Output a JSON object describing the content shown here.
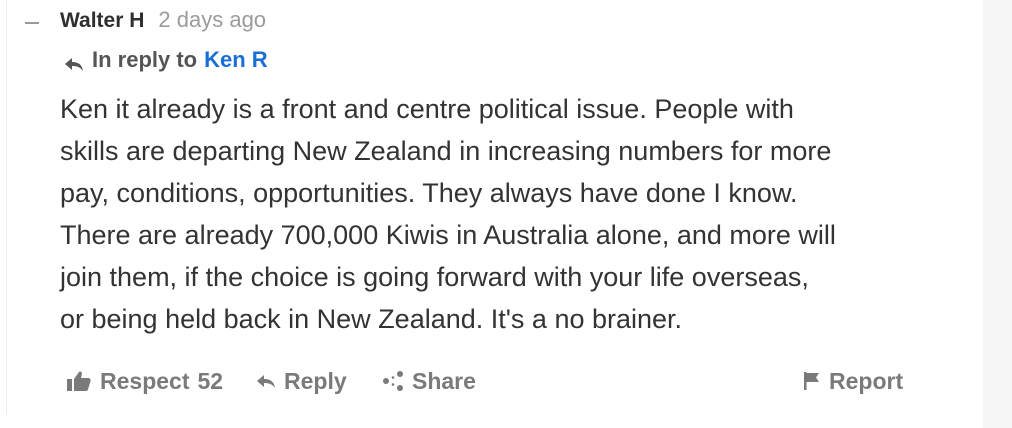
{
  "comment": {
    "author": "Walter H",
    "timestamp": "2 days ago",
    "reply_prefix": "In reply to",
    "reply_target": "Ken R",
    "body_lines": [
      "Ken it already is a front and centre political issue. People with",
      "skills are departing New Zealand in increasing numbers for more",
      "pay, conditions, opportunities. They always have done I know.",
      "There are already 700,000 Kiwis in Australia alone, and more will",
      "join them, if the choice is going forward with your life overseas,",
      "or being held back in New Zealand. It's a no brainer."
    ]
  },
  "actions": {
    "respect_label": "Respect",
    "respect_count": "52",
    "reply_label": "Reply",
    "share_label": "Share",
    "report_label": "Report"
  },
  "icons": {
    "collapse": "minus-icon",
    "reply_to": "reply-arrow-icon",
    "respect": "thumbs-up-icon",
    "reply": "reply-arrow-icon",
    "share": "share-icon",
    "report": "flag-icon"
  },
  "colors": {
    "link": "#1a6fd6",
    "muted": "#7a7a7a",
    "text": "#333333"
  }
}
